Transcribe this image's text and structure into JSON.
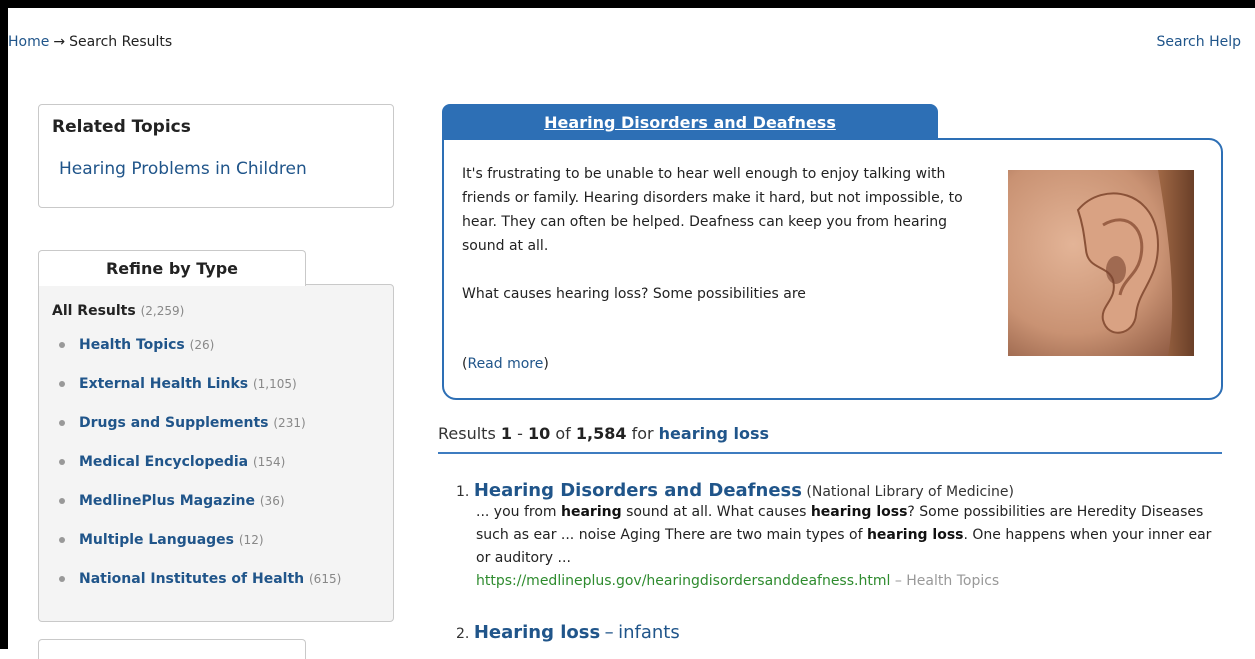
{
  "breadcrumb": {
    "home": "Home",
    "arrow": "→",
    "current": "Search Results"
  },
  "search_help": "Search Help",
  "related_topics": {
    "title": "Related Topics",
    "items": [
      "Hearing Problems in Children"
    ]
  },
  "refine": {
    "title": "Refine by Type",
    "all_label": "All Results",
    "all_count": "(2,259)",
    "items": [
      {
        "label": "Health Topics",
        "count": "(26)"
      },
      {
        "label": "External Health Links",
        "count": "(1,105)"
      },
      {
        "label": "Drugs and Supplements",
        "count": "(231)"
      },
      {
        "label": "Medical Encyclopedia",
        "count": "(154)"
      },
      {
        "label": "MedlinePlus Magazine",
        "count": "(36)"
      },
      {
        "label": "Multiple Languages",
        "count": "(12)"
      },
      {
        "label": "National Institutes of Health",
        "count": "(615)"
      }
    ]
  },
  "featured": {
    "title": "Hearing Disorders and Deafness",
    "paragraph": "It's frustrating to be unable to hear well enough to enjoy talking with friends or family. Hearing disorders make it hard, but not impossible, to hear. They can often be helped. Deafness can keep you from hearing sound at all.",
    "question": "What causes hearing loss? Some possibilities are",
    "read_more_open": "(",
    "read_more": "Read more",
    "read_more_close": ")",
    "image_icon": "ear-photo"
  },
  "results_header": {
    "prefix": "Results",
    "start": "1",
    "dash": "-",
    "end": "10",
    "of": "of",
    "total": "1,584",
    "for": "for",
    "query": "hearing loss"
  },
  "results": [
    {
      "num": "1.",
      "title": "Hearing Disorders and Deafness",
      "source": "(National Library of Medicine)",
      "snippet_parts": [
        "... you from ",
        "hearing",
        " sound at all. What causes ",
        "hearing loss",
        "? Some possibilities are Heredity Diseases such as ear ... noise Aging There are two main types of ",
        "hearing loss",
        ". One happens when your inner ear or auditory ..."
      ],
      "url": "https://medlineplus.gov/hearingdisordersanddeafness.html",
      "category_sep": "–",
      "category": "Health Topics"
    },
    {
      "num": "2.",
      "title": "Hearing loss",
      "dash": "–",
      "subtitle": "infants"
    }
  ],
  "colors": {
    "accent": "#2d6fb5",
    "link": "#20558a",
    "url": "#2e8b2e",
    "panel_bg": "#f4f4f4"
  }
}
